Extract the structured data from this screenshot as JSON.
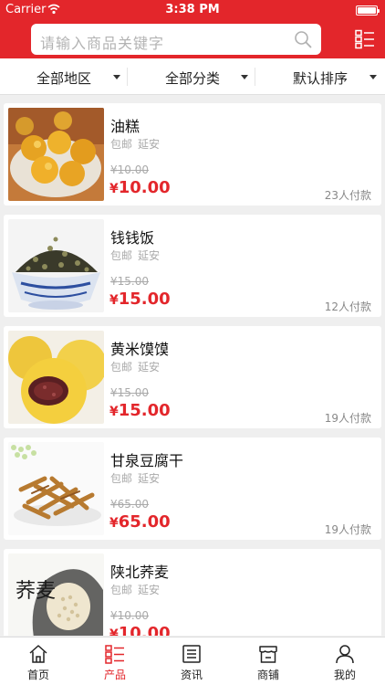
{
  "status_bar": {
    "carrier": "Carrier",
    "time": "3:38 PM"
  },
  "search": {
    "placeholder": "请输入商品关键字"
  },
  "filters": [
    {
      "label": "全部地区"
    },
    {
      "label": "全部分类"
    },
    {
      "label": "默认排序"
    }
  ],
  "products": [
    {
      "name": "油糕",
      "tags": [
        "包邮",
        "延安"
      ],
      "old_price": "¥10.00",
      "price_symbol": "¥",
      "price": "10.00",
      "sold": "23人付款",
      "image": "fried-cakes"
    },
    {
      "name": "钱钱饭",
      "tags": [
        "包邮",
        "延安"
      ],
      "old_price": "¥15.00",
      "price_symbol": "¥",
      "price": "15.00",
      "sold": "12人付款",
      "image": "bean-flakes-bowl"
    },
    {
      "name": "黄米馍馍",
      "tags": [
        "包邮",
        "延安"
      ],
      "old_price": "¥15.00",
      "price_symbol": "¥",
      "price": "15.00",
      "sold": "19人付款",
      "image": "millet-buns"
    },
    {
      "name": "甘泉豆腐干",
      "tags": [
        "包邮",
        "延安"
      ],
      "old_price": "¥65.00",
      "price_symbol": "¥",
      "price": "65.00",
      "sold": "19人付款",
      "image": "dried-tofu-strips"
    },
    {
      "name": "陕北荞麦",
      "tags": [
        "包邮",
        "延安"
      ],
      "old_price": "¥10.00",
      "price_symbol": "¥",
      "price": "10.00",
      "sold": "",
      "image": "buckwheat-grain",
      "image_text": "荞麦"
    }
  ],
  "tabs": [
    {
      "label": "首页",
      "icon": "home-icon"
    },
    {
      "label": "产品",
      "icon": "list-icon",
      "active": true
    },
    {
      "label": "资讯",
      "icon": "news-icon"
    },
    {
      "label": "商铺",
      "icon": "store-icon"
    },
    {
      "label": "我的",
      "icon": "user-icon"
    }
  ],
  "colors": {
    "brand": "#e3262b",
    "background": "#efefef"
  }
}
